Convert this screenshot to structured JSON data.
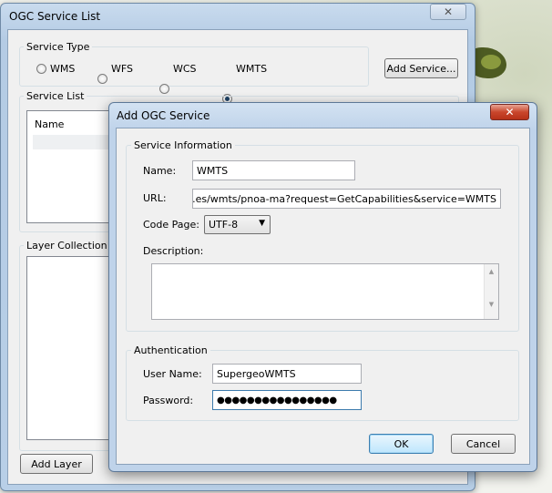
{
  "back_window": {
    "title": "OGC Service List",
    "close_label": "✕",
    "service_type": {
      "label": "Service Type",
      "options": [
        "WMS",
        "WFS",
        "WCS",
        "WMTS"
      ],
      "selected": "WMTS"
    },
    "add_service_label": "Add Service...",
    "service_list": {
      "label": "Service List",
      "column_name": "Name"
    },
    "layer_collection_label": "Layer Collection",
    "add_layer_label": "Add Layer"
  },
  "dialog": {
    "title": "Add OGC Service",
    "close_label": "✕",
    "service_info_label": "Service Information",
    "name_label": "Name:",
    "name_value": "WMTS",
    "url_label": "URL:",
    "url_value": "www.ign.es/wmts/pnoa-ma?request=GetCapabilities&service=WMTS",
    "code_page_label": "Code Page:",
    "code_page_value": "UTF-8",
    "description_label": "Description:",
    "description_value": "",
    "authentication_label": "Authentication",
    "user_name_label": "User Name:",
    "user_name_value": "SupergeoWMTS",
    "password_label": "Password:",
    "password_value": "●●●●●●●●●●●●●●●●",
    "ok_label": "OK",
    "cancel_label": "Cancel"
  }
}
